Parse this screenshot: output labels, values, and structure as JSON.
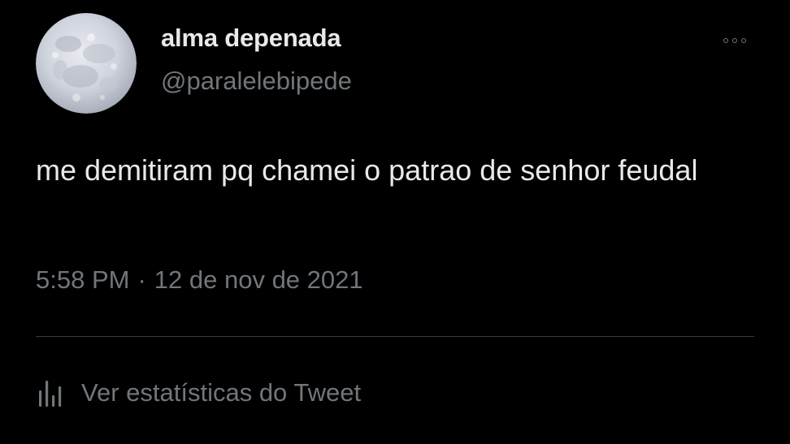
{
  "tweet": {
    "author": {
      "display_name": "alma depenada",
      "handle": "@paralelebipede",
      "avatar": "full-moon-photo"
    },
    "more_icon": "more-horizontal-icon",
    "text": "me demitiram pq chamei o patrao de senhor feudal",
    "time": "5:58 PM",
    "separator": "·",
    "date": "12 de nov de 2021",
    "stats": {
      "icon": "analytics-bars-icon",
      "label": "Ver estatísticas do Tweet"
    }
  },
  "colors": {
    "background": "#000000",
    "primary_text": "#e7e9ea",
    "secondary_text": "#71767b",
    "divider": "#3a3d40"
  }
}
